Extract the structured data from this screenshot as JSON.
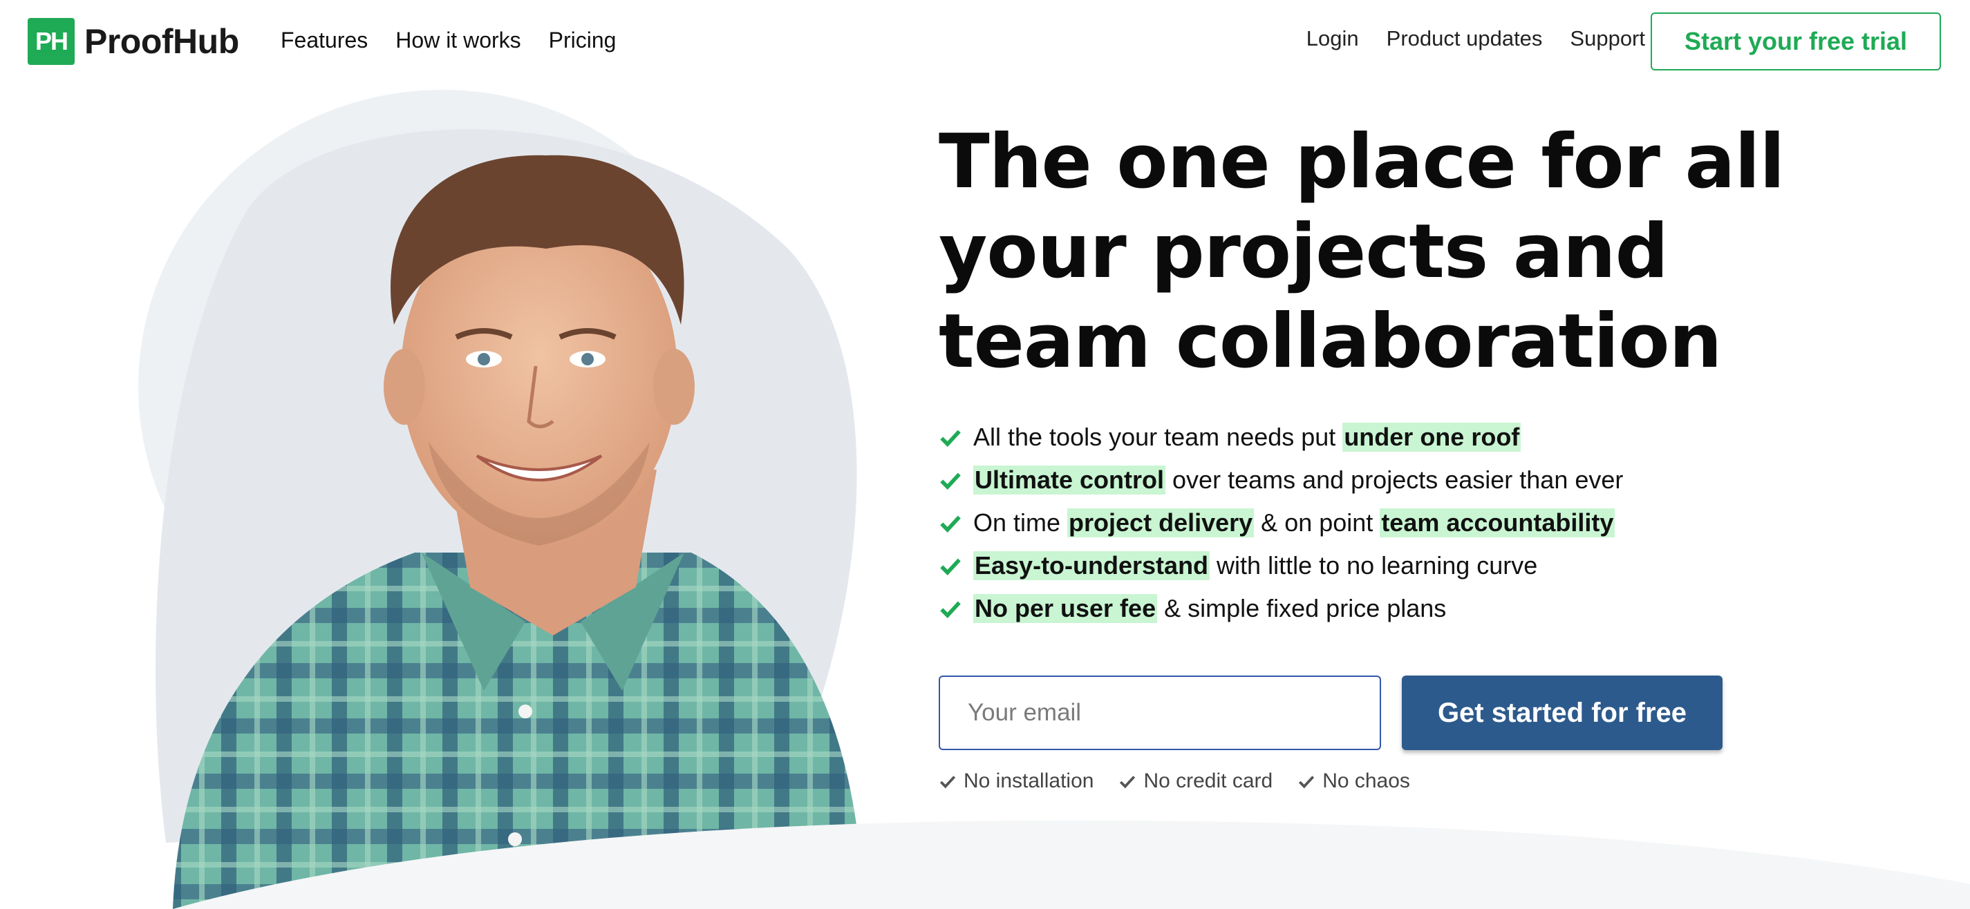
{
  "brand": {
    "logo_mark": "PH",
    "name": "ProofHub",
    "accent_color": "#1faa55",
    "cta_color": "#2d5a8c",
    "highlight_color": "#c9f5d2"
  },
  "nav": {
    "main": [
      "Features",
      "How it works",
      "Pricing"
    ],
    "secondary": [
      "Login",
      "Product updates",
      "Support"
    ],
    "trial_button": "Start your free trial"
  },
  "hero": {
    "headline": "The one place for all your projects and team collaboration",
    "image_icon": "smiling-man-photo",
    "benefits": [
      {
        "parts": [
          {
            "text": "All the tools your team needs put "
          },
          {
            "text": "under one roof",
            "hl": true
          }
        ]
      },
      {
        "parts": [
          {
            "text": "Ultimate control",
            "hl": true
          },
          {
            "text": " over teams and projects easier than ever"
          }
        ]
      },
      {
        "parts": [
          {
            "text": "On time "
          },
          {
            "text": "project delivery",
            "hl": true
          },
          {
            "text": " & on point "
          },
          {
            "text": "team accountability",
            "hl": true
          }
        ]
      },
      {
        "parts": [
          {
            "text": "Easy-to-understand",
            "hl": true
          },
          {
            "text": " with little to no learning curve"
          }
        ]
      },
      {
        "parts": [
          {
            "text": "No per user fee",
            "hl": true
          },
          {
            "text": " & simple fixed price plans"
          }
        ]
      }
    ],
    "email_placeholder": "Your email",
    "cta_label": "Get started for free",
    "assurances": [
      "No installation",
      "No credit card",
      "No chaos"
    ]
  }
}
